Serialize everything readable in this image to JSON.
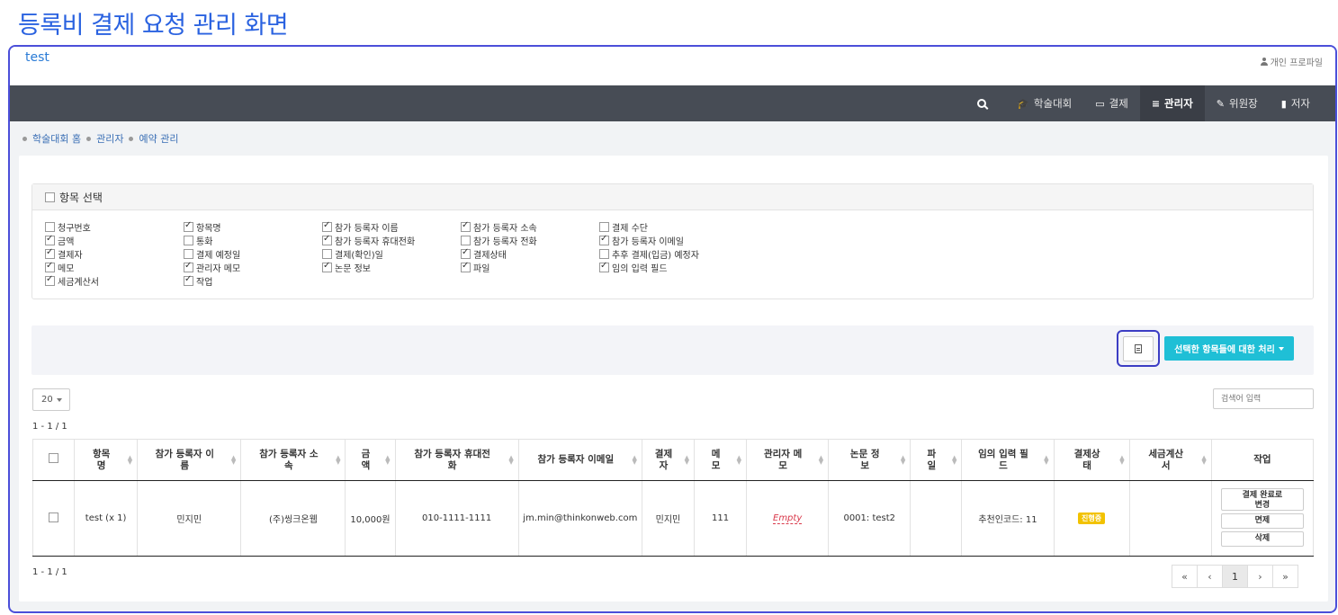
{
  "heading": "등록비 결제 요청 관리 화면",
  "topbar": {
    "brand": "test",
    "profile": "개인 프로파일"
  },
  "nav": {
    "items": [
      {
        "label": "학술대회",
        "icon": "graduation-cap-icon",
        "glyph": "🎓"
      },
      {
        "label": "결제",
        "icon": "credit-card-icon",
        "glyph": "▭"
      },
      {
        "label": "관리자",
        "icon": "list-icon",
        "glyph": "≡"
      },
      {
        "label": "위원장",
        "icon": "gavel-icon",
        "glyph": "✎"
      },
      {
        "label": "저자",
        "icon": "book-icon",
        "glyph": "▮"
      }
    ],
    "active_index": 2
  },
  "breadcrumb": [
    "학술대회 홈",
    "관리자",
    "예약 관리"
  ],
  "column_select": {
    "title": "항목 선택",
    "options": [
      {
        "label": "청구번호",
        "checked": false
      },
      {
        "label": "항목명",
        "checked": true
      },
      {
        "label": "참가 등록자 이름",
        "checked": true
      },
      {
        "label": "참가 등록자 소속",
        "checked": true
      },
      {
        "label": "결제 수단",
        "checked": false
      },
      {
        "label": "금액",
        "checked": true
      },
      {
        "label": "통화",
        "checked": false
      },
      {
        "label": "참가 등록자 휴대전화",
        "checked": true
      },
      {
        "label": "참가 등록자 전화",
        "checked": false
      },
      {
        "label": "참가 등록자 이메일",
        "checked": true
      },
      {
        "label": "결제자",
        "checked": true
      },
      {
        "label": "결제 예정일",
        "checked": false
      },
      {
        "label": "결제(확인)일",
        "checked": false
      },
      {
        "label": "결제상태",
        "checked": true
      },
      {
        "label": "추후 결제(입금) 예정자",
        "checked": false
      },
      {
        "label": "메모",
        "checked": true
      },
      {
        "label": "관리자 메모",
        "checked": true
      },
      {
        "label": "논문 정보",
        "checked": true
      },
      {
        "label": "파일",
        "checked": true
      },
      {
        "label": "임의 입력 필드",
        "checked": true
      },
      {
        "label": "세금계산서",
        "checked": true
      },
      {
        "label": "작업",
        "checked": true
      }
    ]
  },
  "actions": {
    "process_label": "선택한 항목들에 대한 처리"
  },
  "list": {
    "page_size": "20",
    "search_placeholder": "검색어 입력",
    "range": "1 - 1 / 1",
    "headers": [
      "항목\n명",
      "참가 등록자 이\n름",
      "참가 등록자 소\n속",
      "금\n액",
      "참가 등록자 휴대전\n화",
      "참가 등록자 이메일",
      "결제\n자",
      "메\n모",
      "관리자 메\n모",
      "논문 정\n보",
      "파\n일",
      "임의 입력 필\n드",
      "결제상\n태",
      "세금계산\n서",
      "작업"
    ],
    "row": {
      "item": "test (x 1)",
      "name": "민지민",
      "affiliation": "(주)씽크온웹",
      "amount": "10,000원",
      "mobile": "010-1111-1111",
      "email": "jm.min@thinkonweb.com",
      "payer": "민지민",
      "memo": "111",
      "admin_memo": "Empty",
      "paper": "0001: test2",
      "file": "",
      "custom_field": "추천인코드: 11",
      "status": "진행중",
      "tax_invoice": "",
      "buttons": [
        "결제 완료로\n변경",
        "면제",
        "삭제"
      ]
    }
  },
  "pagination": [
    "«",
    "‹",
    "1",
    "›",
    "»"
  ],
  "colors": {
    "accent": "#1fbfd6",
    "nav_bg": "#474c55",
    "heading": "#2a62e0",
    "badge": "#f2c200"
  }
}
